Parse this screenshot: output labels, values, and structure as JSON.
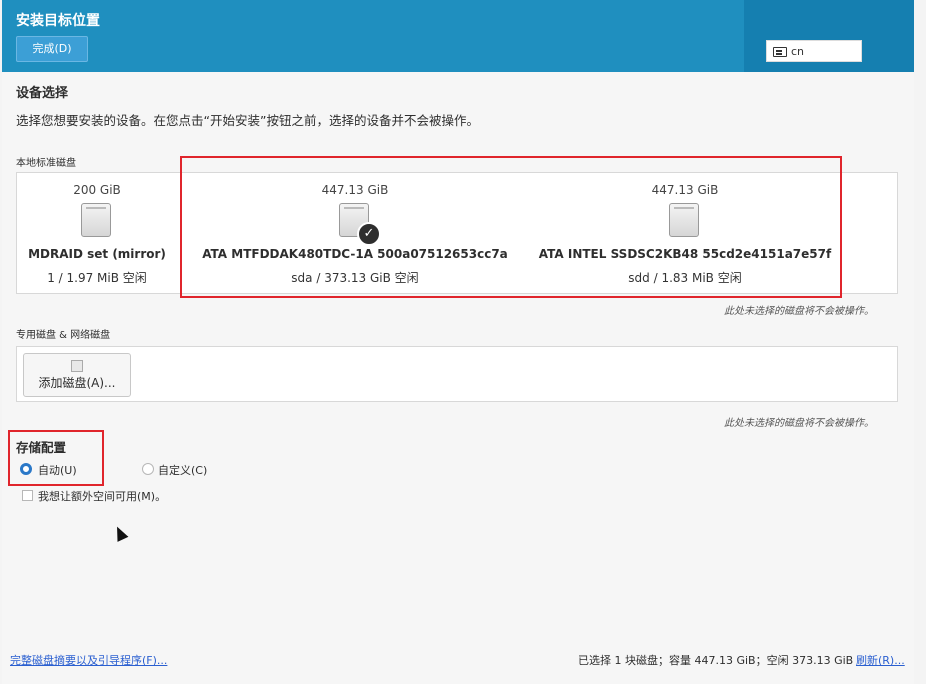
{
  "header": {
    "title": "安装目标位置",
    "done_label": "完成(D)",
    "keyboard_layout": "cn"
  },
  "device_selection": {
    "title": "设备选择",
    "description": "选择您想要安装的设备。在您点击“开始安装”按钮之前，选择的设备并不会被操作。"
  },
  "local_disks": {
    "title": "本地标准磁盘",
    "note": "此处未选择的磁盘将不会被操作。",
    "disks": [
      {
        "size": "200 GiB",
        "name": "MDRAID set (mirror)",
        "info": "1  /  1.97 MiB 空闲",
        "selected": false
      },
      {
        "size": "447.13 GiB",
        "name": "ATA MTFDDAK480TDC-1A 500a07512653cc7a",
        "info": "sda        /        373.13 GiB 空闲",
        "selected": true
      },
      {
        "size": "447.13 GiB",
        "name": "ATA INTEL SSDSC2KB48 55cd2e4151a7e57f",
        "info": "sdd        /        1.83 MiB 空闲",
        "selected": false
      }
    ]
  },
  "specialized_disks": {
    "title": "专用磁盘 & 网络磁盘",
    "add_button_label": "添加磁盘(A)...",
    "note": "此处未选择的磁盘将不会被操作。"
  },
  "storage_config": {
    "title": "存储配置",
    "options": [
      {
        "label": "自动(U)",
        "selected": true
      },
      {
        "label": "自定义(C)",
        "selected": false
      }
    ],
    "extra_space_label": "我想让额外空间可用(M)。",
    "extra_space_checked": false
  },
  "footer": {
    "summary_link": "完整磁盘摘要以及引导程序(F)...",
    "status": "已选择 1 块磁盘；容量 447.13 GiB；空闲 373.13 GiB",
    "refresh_link": "刷新(R)..."
  }
}
